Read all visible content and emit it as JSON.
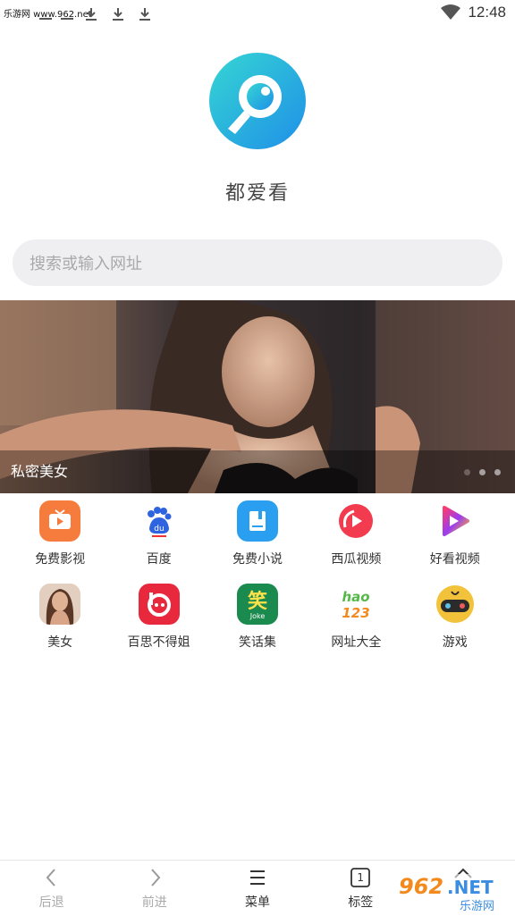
{
  "status_bar": {
    "watermark": "乐游网 www.962.net",
    "time": "12:48",
    "icons": [
      "minus-icon",
      "minus-icon",
      "download-icon",
      "download-icon",
      "download-icon",
      "wifi-icon"
    ]
  },
  "app": {
    "title": "都爱看"
  },
  "search": {
    "placeholder": "搜索或输入网址"
  },
  "banner": {
    "caption": "私密美女",
    "slides": 3,
    "active_slide": 1
  },
  "shortcuts": [
    {
      "label": "免费影视",
      "icon": "tv-play-icon",
      "color": "#f57c3c"
    },
    {
      "label": "百度",
      "icon": "baidu-paw-icon",
      "color": "#2f64e0"
    },
    {
      "label": "免费小说",
      "icon": "book-icon",
      "color": "#2a9ff0"
    },
    {
      "label": "西瓜视频",
      "icon": "xigua-play-icon",
      "color": "#f23b4e"
    },
    {
      "label": "好看视频",
      "icon": "haokan-play-icon",
      "color": "#9b3cf0"
    },
    {
      "label": "美女",
      "icon": "woman-photo-icon",
      "color": "#c98e6e"
    },
    {
      "label": "百思不得姐",
      "icon": "budejie-icon",
      "color": "#e8283c"
    },
    {
      "label": "笑话集",
      "icon": "joke-icon",
      "color": "#1b8a4f"
    },
    {
      "label": "网址大全",
      "icon": "hao123-icon",
      "color": "#55b948"
    },
    {
      "label": "游戏",
      "icon": "game-controller-icon",
      "color": "#f2c23a"
    }
  ],
  "bottom_nav": [
    {
      "label": "后退",
      "icon": "chevron-left-icon",
      "enabled": false
    },
    {
      "label": "前进",
      "icon": "chevron-right-icon",
      "enabled": false
    },
    {
      "label": "菜单",
      "icon": "menu-icon",
      "enabled": true
    },
    {
      "label": "标签",
      "icon": "tab-count-icon",
      "count": "1",
      "enabled": true
    },
    {
      "label": "",
      "icon": "home-icon",
      "enabled": true
    }
  ],
  "watermark_bottom": "962.NET 乐游网"
}
